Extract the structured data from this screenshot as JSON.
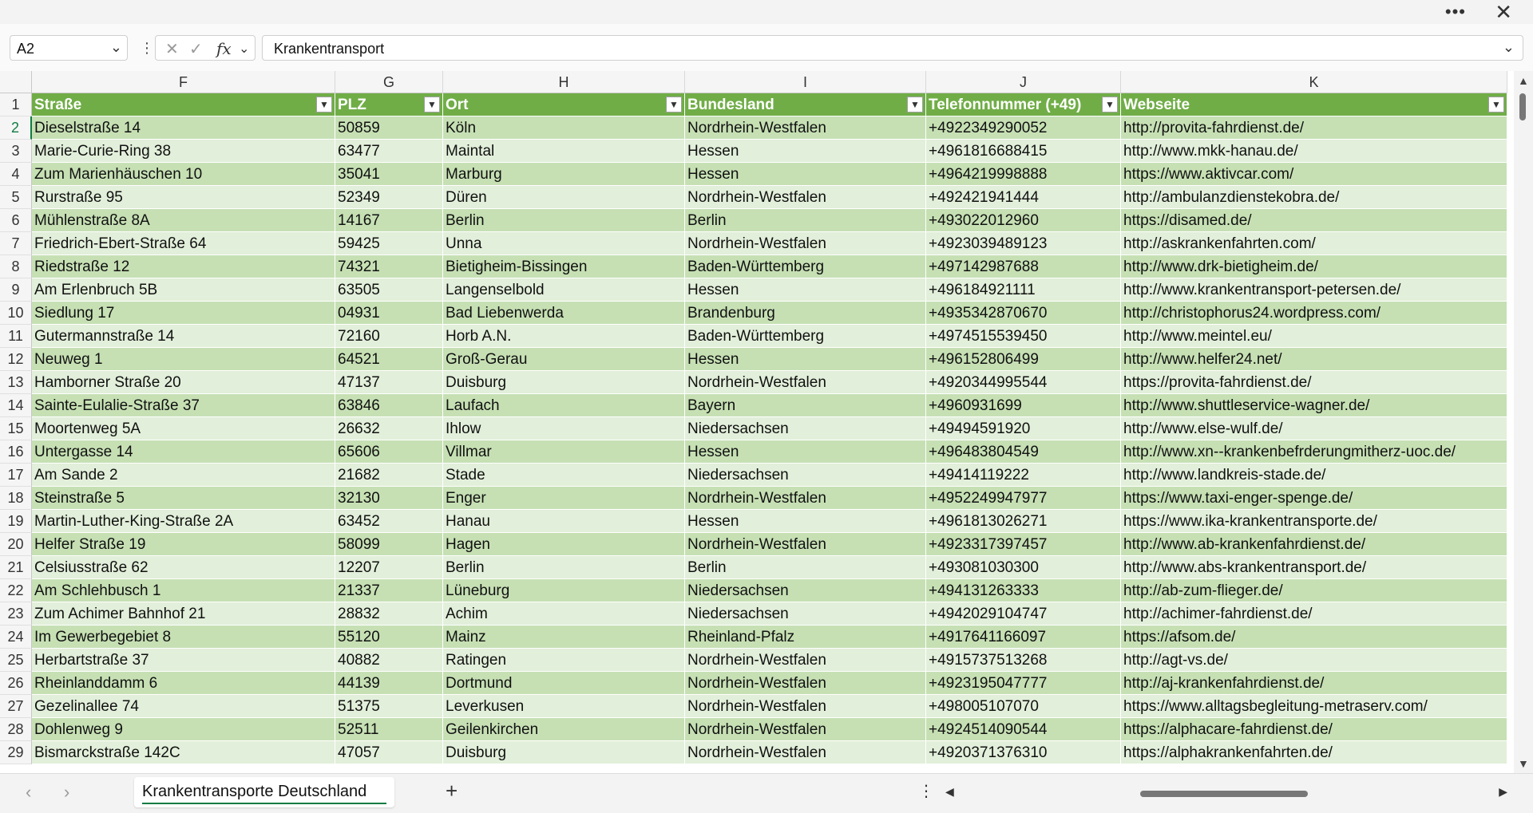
{
  "window": {
    "more_label": "•••",
    "close_label": "✕"
  },
  "formula_bar": {
    "name_box": "A2",
    "cancel_icon": "✕",
    "enter_icon": "✓",
    "fx_label": "fx",
    "value": "Krankentransport"
  },
  "columns": [
    {
      "letter": "F",
      "header": "Straße"
    },
    {
      "letter": "G",
      "header": "PLZ"
    },
    {
      "letter": "H",
      "header": "Ort"
    },
    {
      "letter": "I",
      "header": "Bundesland"
    },
    {
      "letter": "J",
      "header": "Telefonnummer (+49)"
    },
    {
      "letter": "K",
      "header": "Webseite"
    }
  ],
  "header_row_number": "1",
  "rows": [
    {
      "n": "2",
      "cells": [
        "Dieselstraße 14",
        "50859",
        "Köln",
        "Nordrhein-Westfalen",
        "+4922349290052",
        "http://provita-fahrdienst.de/"
      ]
    },
    {
      "n": "3",
      "cells": [
        "Marie-Curie-Ring 38",
        "63477",
        "Maintal",
        "Hessen",
        "+4961816688415",
        "http://www.mkk-hanau.de/"
      ]
    },
    {
      "n": "4",
      "cells": [
        "Zum Marienhäuschen 10",
        "35041",
        "Marburg",
        "Hessen",
        "+4964219998888",
        "https://www.aktivcar.com/"
      ]
    },
    {
      "n": "5",
      "cells": [
        "Rurstraße 95",
        "52349",
        "Düren",
        "Nordrhein-Westfalen",
        "+492421941444",
        "http://ambulanzdienstekobra.de/"
      ]
    },
    {
      "n": "6",
      "cells": [
        "Mühlenstraße 8A",
        "14167",
        "Berlin",
        "Berlin",
        "+493022012960",
        "https://disamed.de/"
      ]
    },
    {
      "n": "7",
      "cells": [
        "Friedrich-Ebert-Straße 64",
        "59425",
        "Unna",
        "Nordrhein-Westfalen",
        "+4923039489123",
        "http://askrankenfahrten.com/"
      ]
    },
    {
      "n": "8",
      "cells": [
        "Riedstraße 12",
        "74321",
        "Bietigheim-Bissingen",
        "Baden-Württemberg",
        "+497142987688",
        "http://www.drk-bietigheim.de/"
      ]
    },
    {
      "n": "9",
      "cells": [
        "Am Erlenbruch 5B",
        "63505",
        "Langenselbold",
        "Hessen",
        "+496184921111",
        "http://www.krankentransport-petersen.de/"
      ]
    },
    {
      "n": "10",
      "cells": [
        "Siedlung 17",
        "04931",
        "Bad Liebenwerda",
        "Brandenburg",
        "+4935342870670",
        "http://christophorus24.wordpress.com/"
      ]
    },
    {
      "n": "11",
      "cells": [
        "Gutermannstraße 14",
        "72160",
        "Horb A.N.",
        "Baden-Württemberg",
        "+4974515539450",
        "http://www.meintel.eu/"
      ]
    },
    {
      "n": "12",
      "cells": [
        "Neuweg 1",
        "64521",
        "Groß-Gerau",
        "Hessen",
        "+496152806499",
        "http://www.helfer24.net/"
      ]
    },
    {
      "n": "13",
      "cells": [
        "Hamborner Straße 20",
        "47137",
        "Duisburg",
        "Nordrhein-Westfalen",
        "+4920344995544",
        "https://provita-fahrdienst.de/"
      ]
    },
    {
      "n": "14",
      "cells": [
        "Sainte-Eulalie-Straße 37",
        "63846",
        "Laufach",
        "Bayern",
        "+4960931699",
        "http://www.shuttleservice-wagner.de/"
      ]
    },
    {
      "n": "15",
      "cells": [
        "Moortenweg 5A",
        "26632",
        "Ihlow",
        "Niedersachsen",
        "+49494591920",
        "http://www.else-wulf.de/"
      ]
    },
    {
      "n": "16",
      "cells": [
        "Untergasse 14",
        "65606",
        "Villmar",
        "Hessen",
        "+496483804549",
        "http://www.xn--krankenbefrderungmitherz-uoc.de/"
      ]
    },
    {
      "n": "17",
      "cells": [
        "Am Sande 2",
        "21682",
        "Stade",
        "Niedersachsen",
        "+49414119222",
        "http://www.landkreis-stade.de/"
      ]
    },
    {
      "n": "18",
      "cells": [
        "Steinstraße 5",
        "32130",
        "Enger",
        "Nordrhein-Westfalen",
        "+4952249947977",
        "https://www.taxi-enger-spenge.de/"
      ]
    },
    {
      "n": "19",
      "cells": [
        "Martin-Luther-King-Straße 2A",
        "63452",
        "Hanau",
        "Hessen",
        "+4961813026271",
        "https://www.ika-krankentransporte.de/"
      ]
    },
    {
      "n": "20",
      "cells": [
        "Helfer Straße 19",
        "58099",
        "Hagen",
        "Nordrhein-Westfalen",
        "+4923317397457",
        "http://www.ab-krankenfahrdienst.de/"
      ]
    },
    {
      "n": "21",
      "cells": [
        "Celsiusstraße 62",
        "12207",
        "Berlin",
        "Berlin",
        "+493081030300",
        "http://www.abs-krankentransport.de/"
      ]
    },
    {
      "n": "22",
      "cells": [
        "Am Schlehbusch 1",
        "21337",
        "Lüneburg",
        "Niedersachsen",
        "+494131263333",
        "http://ab-zum-flieger.de/"
      ]
    },
    {
      "n": "23",
      "cells": [
        "Zum Achimer Bahnhof 21",
        "28832",
        "Achim",
        "Niedersachsen",
        "+4942029104747",
        "http://achimer-fahrdienst.de/"
      ]
    },
    {
      "n": "24",
      "cells": [
        "Im Gewerbegebiet 8",
        "55120",
        "Mainz",
        "Rheinland-Pfalz",
        "+4917641166097",
        "https://afsom.de/"
      ]
    },
    {
      "n": "25",
      "cells": [
        "Herbartstraße 37",
        "40882",
        "Ratingen",
        "Nordrhein-Westfalen",
        "+4915737513268",
        "http://agt-vs.de/"
      ]
    },
    {
      "n": "26",
      "cells": [
        "Rheinlanddamm 6",
        "44139",
        "Dortmund",
        "Nordrhein-Westfalen",
        "+4923195047777",
        "http://aj-krankenfahrdienst.de/"
      ]
    },
    {
      "n": "27",
      "cells": [
        "Gezelinallee 74",
        "51375",
        "Leverkusen",
        "Nordrhein-Westfalen",
        "+498005107070",
        "https://www.alltagsbegleitung-metraserv.com/"
      ]
    },
    {
      "n": "28",
      "cells": [
        "Dohlenweg 9",
        "52511",
        "Geilenkirchen",
        "Nordrhein-Westfalen",
        "+4924514090544",
        "https://alphacare-fahrdienst.de/"
      ]
    },
    {
      "n": "29",
      "cells": [
        "Bismarckstraße 142C",
        "47057",
        "Duisburg",
        "Nordrhein-Westfalen",
        "+4920371376310",
        "https://alphakrankenfahrten.de/"
      ]
    }
  ],
  "sheet_tabs": {
    "active": "Krankentransporte Deutschland",
    "add_label": "+"
  },
  "colors": {
    "header_green": "#70ad47",
    "band_dark": "#c6e0b4",
    "band_light": "#e2efda",
    "accent": "#107c41"
  }
}
